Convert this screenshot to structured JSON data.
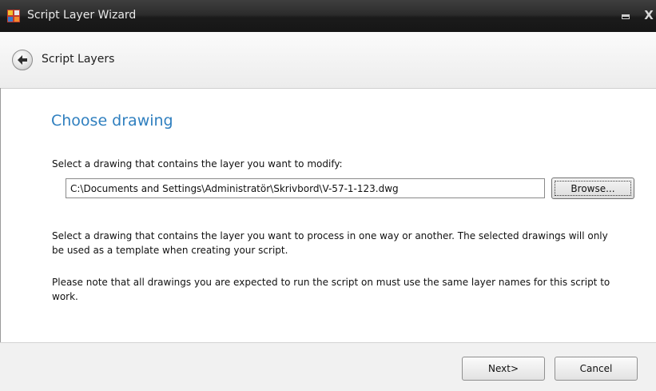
{
  "window": {
    "title": "Script Layer Wizard",
    "icon": "app-icon",
    "minimize_icon": "minimize-icon",
    "close_label": "X"
  },
  "nav": {
    "back_icon": "back-arrow-icon",
    "title": "Script Layers"
  },
  "content": {
    "heading": "Choose drawing",
    "select_label": "Select a drawing that contains the layer you want to modify:",
    "path_value": "C:\\Documents and Settings\\Administratör\\Skrivbord\\V-57-1-123.dwg",
    "browse_label": "Browse...",
    "paragraph1": "Select a drawing that contains the layer you want to process in one way or another. The selected drawings will only be used as a template when creating your script.",
    "paragraph2": "Please note that all drawings you are expected to run the script on must use the same layer names for this script to work."
  },
  "footer": {
    "next_label": "Next>",
    "cancel_label": "Cancel"
  },
  "colors": {
    "heading": "#2f7fbf",
    "titlebar": "#1b1b1b"
  }
}
